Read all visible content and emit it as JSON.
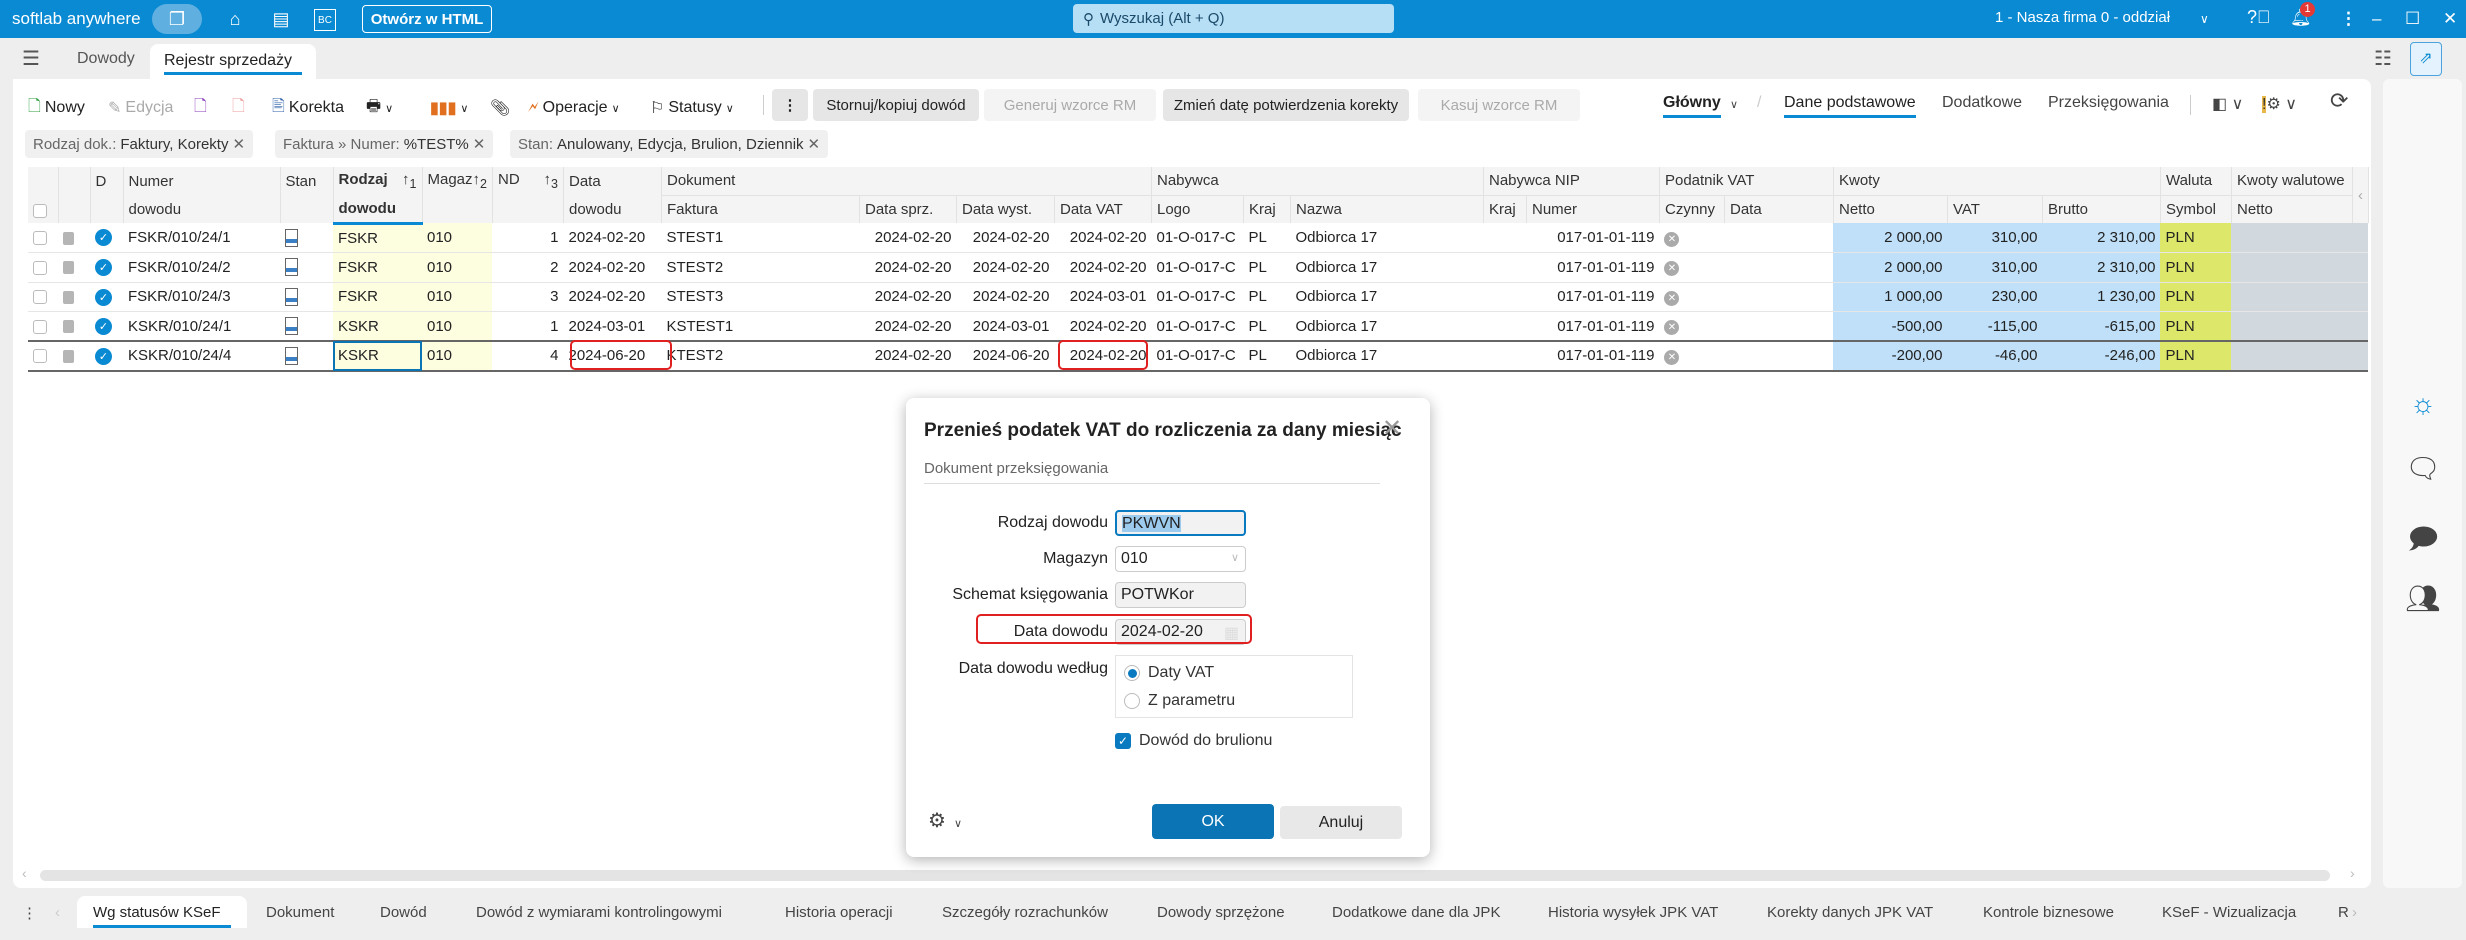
{
  "app": {
    "name": "softlab anywhere",
    "open_html": "Otwórz w HTML",
    "search_placeholder": "Wyszukaj (Alt + Q)",
    "company": "1 - Nasza firma 0 - oddział",
    "notifications": "1",
    "bc_label": "BC"
  },
  "tabs": [
    {
      "label": "Dowody"
    },
    {
      "label": "Rejestr sprzedaży",
      "active": true
    }
  ],
  "toolbar": {
    "new": "Nowy",
    "edit": "Edycja",
    "correction": "Korekta",
    "operations": "Operacje",
    "statuses": "Statusy",
    "reverse_copy": "Stornuj/kopiuj dowód",
    "generate_rm": "Generuj wzorce RM",
    "change_date": "Zmień datę potwierdzenia korekty",
    "delete_rm": "Kasuj wzorce RM"
  },
  "views": {
    "main": "Główny",
    "basic": "Dane podstawowe",
    "additional": "Dodatkowe",
    "rebookings": "Przeksięgowania"
  },
  "filters": [
    {
      "label": "Rodzaj dok.:",
      "value": "Faktury, Korekty"
    },
    {
      "label": "Faktura » Numer:",
      "value": "%TEST%"
    },
    {
      "label": "Stan:",
      "value": "Anulowany, Edycja, Brulion, Dziennik"
    }
  ],
  "grid": {
    "header_top": {
      "d": "D",
      "numer": "Numer",
      "stan": "Stan",
      "rodzaj": "Rodzaj",
      "magazyn": "Magaz",
      "nd": "ND",
      "data": "Data",
      "dokument": "Dokument",
      "nabywca": "Nabywca",
      "nip": "Nabywca NIP",
      "podatnik": "Podatnik VAT",
      "kwoty": "Kwoty",
      "waluta": "Waluta",
      "kwoty_wal": "Kwoty walutowe"
    },
    "header_sub": {
      "numer": "dowodu",
      "rodzaj": "dowodu",
      "data": "dowodu",
      "faktura": "Faktura",
      "data_sprz": "Data sprz.",
      "data_wyst": "Data wyst.",
      "data_vat": "Data VAT",
      "logo": "Logo",
      "kraj": "Kraj",
      "nazwa": "Nazwa",
      "nip_kraj": "Kraj",
      "nip_numer": "Numer",
      "czynny": "Czynny",
      "pod_data": "Data",
      "netto": "Netto",
      "vat": "VAT",
      "brutto": "Brutto",
      "symbol": "Symbol",
      "wal_netto": "Netto"
    },
    "sort_indices": [
      "1",
      "2",
      "3"
    ],
    "rows": [
      {
        "numer": "FSKR/010/24/1",
        "rodzaj": "FSKR",
        "magazyn": "010",
        "nd": "1",
        "data": "2024-02-20",
        "faktura": "STEST1",
        "data_sprz": "2024-02-20",
        "data_wyst": "2024-02-20",
        "data_vat": "2024-02-20",
        "logo": "01-O-017-C",
        "kraj": "PL",
        "nazwa": "Odbiorca 17",
        "nip": "017-01-01-119",
        "netto": "2 000,00",
        "vat": "310,00",
        "brutto": "2 310,00",
        "symbol": "PLN"
      },
      {
        "numer": "FSKR/010/24/2",
        "rodzaj": "FSKR",
        "magazyn": "010",
        "nd": "2",
        "data": "2024-02-20",
        "faktura": "STEST2",
        "data_sprz": "2024-02-20",
        "data_wyst": "2024-02-20",
        "data_vat": "2024-02-20",
        "logo": "01-O-017-C",
        "kraj": "PL",
        "nazwa": "Odbiorca 17",
        "nip": "017-01-01-119",
        "netto": "2 000,00",
        "vat": "310,00",
        "brutto": "2 310,00",
        "symbol": "PLN"
      },
      {
        "numer": "FSKR/010/24/3",
        "rodzaj": "FSKR",
        "magazyn": "010",
        "nd": "3",
        "data": "2024-02-20",
        "faktura": "STEST3",
        "data_sprz": "2024-02-20",
        "data_wyst": "2024-02-20",
        "data_vat": "2024-03-01",
        "logo": "01-O-017-C",
        "kraj": "PL",
        "nazwa": "Odbiorca 17",
        "nip": "017-01-01-119",
        "netto": "1 000,00",
        "vat": "230,00",
        "brutto": "1 230,00",
        "symbol": "PLN"
      },
      {
        "numer": "KSKR/010/24/1",
        "rodzaj": "KSKR",
        "magazyn": "010",
        "nd": "1",
        "data": "2024-03-01",
        "faktura": "KSTEST1",
        "data_sprz": "2024-02-20",
        "data_wyst": "2024-03-01",
        "data_vat": "2024-02-20",
        "logo": "01-O-017-C",
        "kraj": "PL",
        "nazwa": "Odbiorca 17",
        "nip": "017-01-01-119",
        "netto": "-500,00",
        "vat": "-115,00",
        "brutto": "-615,00",
        "symbol": "PLN"
      },
      {
        "numer": "KSKR/010/24/4",
        "rodzaj": "KSKR",
        "magazyn": "010",
        "nd": "4",
        "data": "2024-06-20",
        "faktura": "KTEST2",
        "data_sprz": "2024-02-20",
        "data_wyst": "2024-06-20",
        "data_vat": "2024-02-20",
        "logo": "01-O-017-C",
        "kraj": "PL",
        "nazwa": "Odbiorca 17",
        "nip": "017-01-01-119",
        "netto": "-200,00",
        "vat": "-46,00",
        "brutto": "-246,00",
        "symbol": "PLN",
        "selected": true
      }
    ]
  },
  "dialog": {
    "title": "Przenieś podatek VAT do rozliczenia za dany miesiąc",
    "section": "Dokument przeksięgowania",
    "rodzaj_label": "Rodzaj dowodu",
    "rodzaj_value": "PKWVN",
    "magazyn_label": "Magazyn",
    "magazyn_value": "010",
    "schemat_label": "Schemat księgowania",
    "schemat_value": "POTWKor",
    "data_label": "Data dowodu",
    "data_value": "2024-02-20",
    "wedlug_label": "Data dowodu według",
    "radio_options": [
      "Daty VAT",
      "Z parametru"
    ],
    "radio_selected": "Daty VAT",
    "draft_label": "Dowód do brulionu",
    "draft_checked": true,
    "ok": "OK",
    "cancel": "Anuluj"
  },
  "bottom_tabs": [
    "Wg statusów KSeF",
    "Dokument",
    "Dowód",
    "Dowód z wymiarami kontrolingowymi",
    "Historia operacji",
    "Szczegóły rozrachunków",
    "Dowody sprzężone",
    "Dodatkowe dane dla JPK",
    "Historia wysyłek JPK VAT",
    "Korekty danych JPK VAT",
    "Kontrole biznesowe",
    "KSeF - Wizualizacja",
    "R"
  ],
  "colors": {
    "accent": "#0a8ad2",
    "highlight_red": "#e02020",
    "amount_bg": "#bfe0f8",
    "currency_bg": "#dde86a",
    "type_bg": "#fdfde0"
  }
}
